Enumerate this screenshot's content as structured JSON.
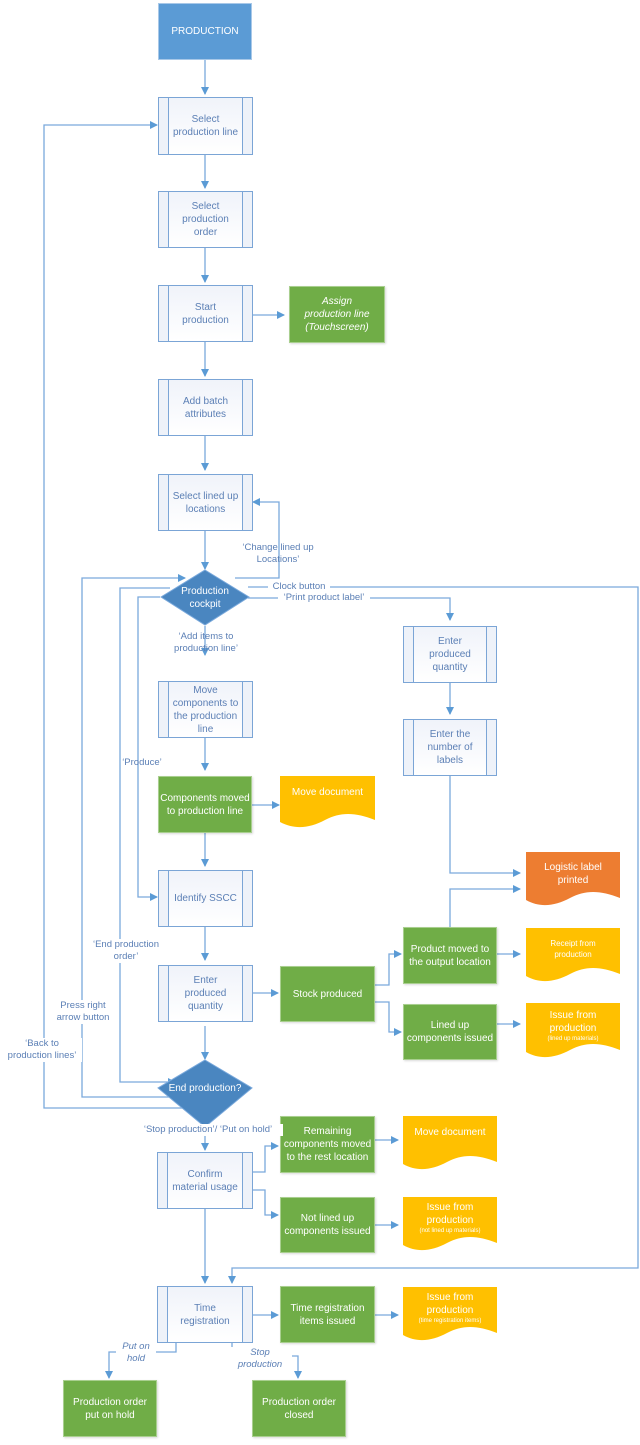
{
  "title": "PRODUCTION",
  "colors": {
    "start": "#5b9bd5",
    "process_border": "#7ba5d6",
    "process_text": "#5b7fb5",
    "decision": "#4a86c0",
    "result": "#70ad47",
    "document": "#ffc000",
    "label_document": "#ed7d31",
    "connector": "#6fa0d8"
  },
  "processes": {
    "select_line": "Select\nproduction line",
    "select_order": "Select\nproduction\norder",
    "start_production": "Start\nproduction",
    "add_batch": "Add batch\nattributes",
    "select_lined_up": "Select lined up\nlocations",
    "move_components": "Move\ncomponents to\nthe production\nline",
    "identify_sscc": "Identify SSCC",
    "enter_qty_left": "Enter\nproduced\nquantity",
    "enter_qty_right": "Enter\nproduced\nquantity",
    "enter_labels": "Enter the\nnumber of\nlabels",
    "confirm_material": "Confirm\nmaterial usage",
    "time_registration": "Time\nregistration"
  },
  "decisions": {
    "cockpit": "Production\ncockpit",
    "end_production": "End production?"
  },
  "results": {
    "assign_line": "Assign\nproduction line\n(Touchscreen)",
    "components_moved": "Components moved\nto production line",
    "stock_produced": "Stock produced",
    "product_moved": "Product moved to\nthe output location",
    "lined_up_issued": "Lined up\ncomponents issued",
    "remaining_moved": "Remaining\ncomponents moved\nto the rest location",
    "not_lined_up_issued": "Not lined up\ncomponents issued",
    "time_items_issued": "Time registration\nitems issued",
    "order_on_hold": "Production order\nput on hold",
    "order_closed": "Production order\nclosed"
  },
  "documents": {
    "move_doc_1": {
      "title": "Move document",
      "sub": ""
    },
    "logistic_label": {
      "title": "Logistic label\nprinted",
      "sub": ""
    },
    "receipt": {
      "title": "Receipt from\nproduction",
      "sub": ""
    },
    "issue_lined_up": {
      "title": "Issue from\nproduction",
      "sub": "(lined up materials)"
    },
    "move_doc_2": {
      "title": "Move document",
      "sub": ""
    },
    "issue_not_lined_up": {
      "title": "Issue from\nproduction",
      "sub": "(not lined up materials)"
    },
    "issue_time": {
      "title": "Issue from\nproduction",
      "sub": "(time registration items)"
    }
  },
  "edge_labels": {
    "change_lined_up": "‘Change lined up\nLocations’",
    "clock_button": "Clock button",
    "print_label": "‘Print product label’",
    "add_items": "‘Add items to\nproduction line’",
    "produce": "‘Produce’",
    "end_order": "‘End production\norder’",
    "press_right": "Press right\narrow button",
    "back_to_lines": "‘Back to\nproduction lines’",
    "stop_or_hold": "‘Stop production’/ ‘Put on hold’",
    "put_on_hold": "Put on\nhold",
    "stop_production": "Stop\nproduction"
  }
}
